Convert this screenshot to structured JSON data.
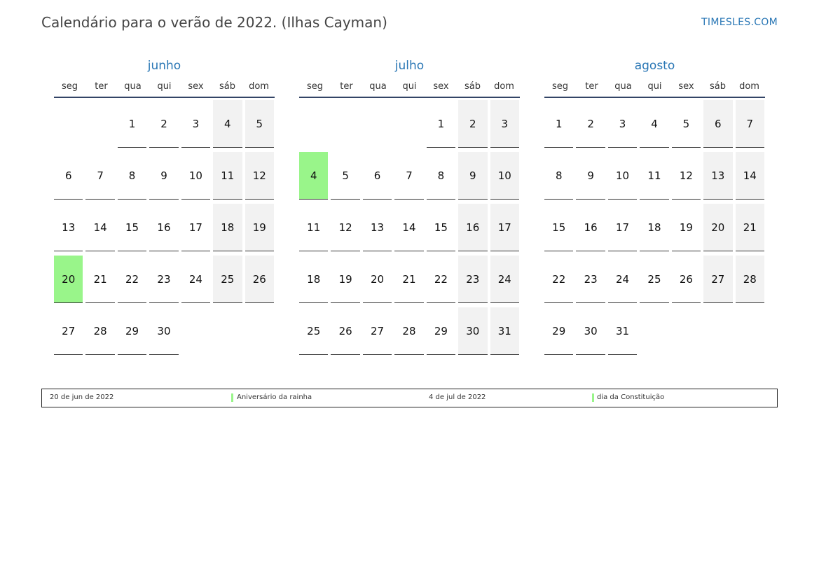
{
  "header": {
    "title": "Calendário para o verão de 2022. (Ilhas Cayman)",
    "site": "TIMESLES.COM"
  },
  "weekdays": [
    "seg",
    "ter",
    "qua",
    "qui",
    "sex",
    "sáb",
    "dom"
  ],
  "colors": {
    "accent": "#2a77b5",
    "holiday": "#99f58a",
    "weekend": "#f2f2f2"
  },
  "months": [
    {
      "name": "junho",
      "offset": 2,
      "days": 30,
      "holidays": [
        20
      ]
    },
    {
      "name": "julho",
      "offset": 4,
      "days": 31,
      "holidays": [
        4
      ]
    },
    {
      "name": "agosto",
      "offset": 0,
      "days": 31,
      "holidays": []
    }
  ],
  "legend": [
    {
      "date": "20 de jun de 2022",
      "name": "Aniversário da rainha"
    },
    {
      "date": "4 de jul de 2022",
      "name": "dia da Constituição"
    }
  ]
}
